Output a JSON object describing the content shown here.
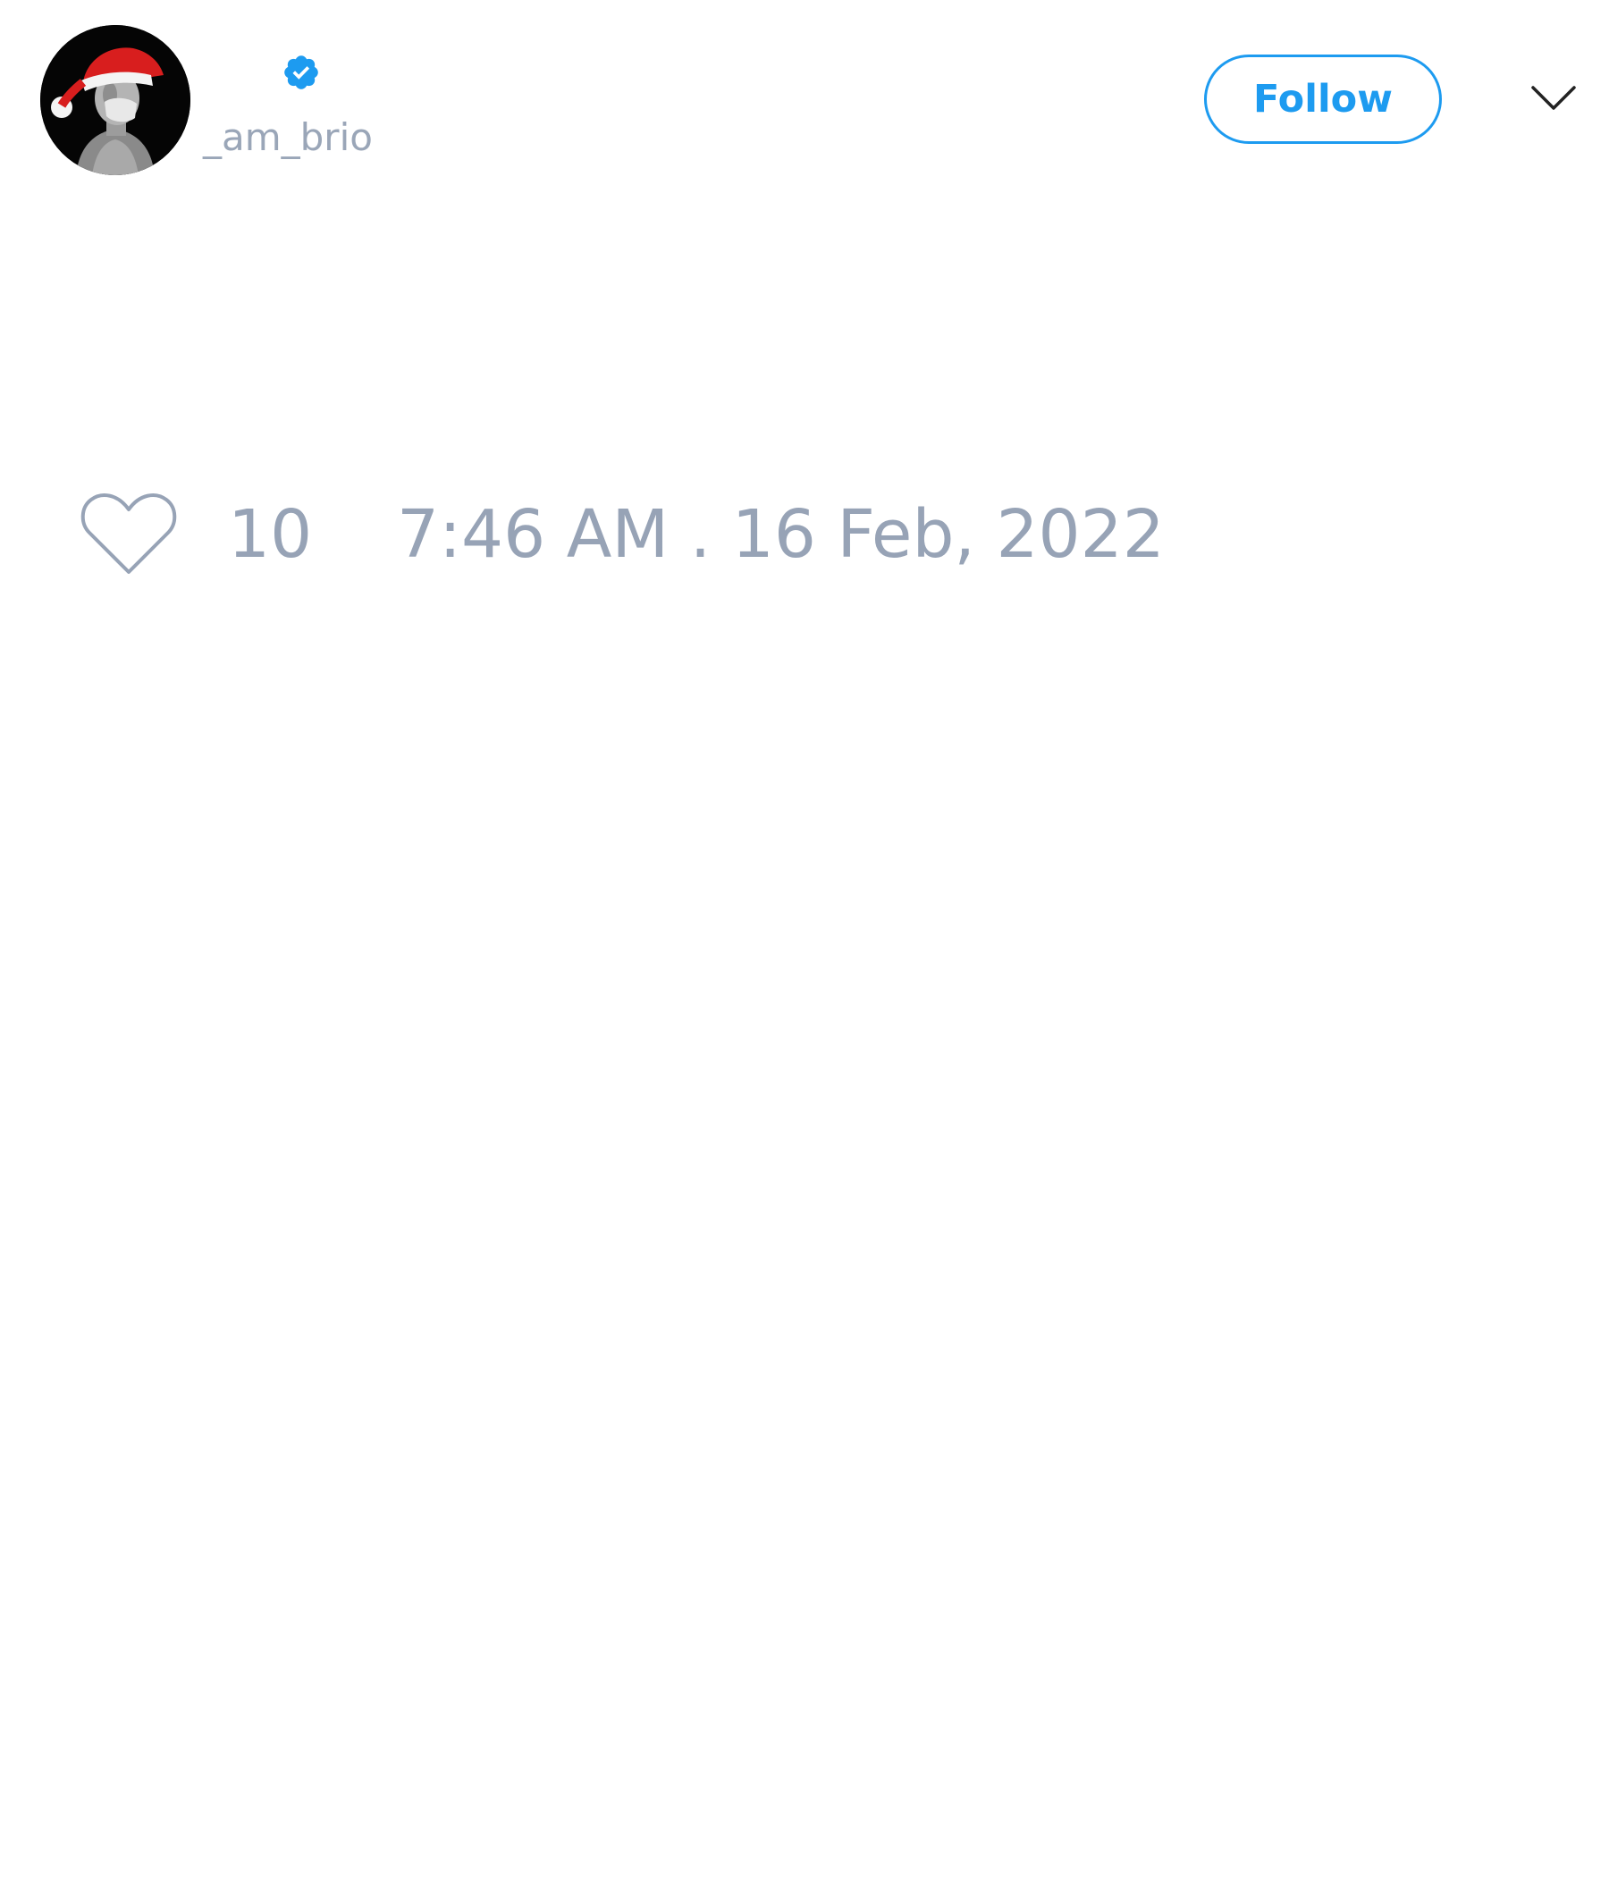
{
  "tweet": {
    "author": {
      "handle": "_am_brio",
      "verified": true,
      "avatar_icon": "avatar-santa-hat-statue"
    },
    "follow_label": "Follow",
    "menu_icon": "chevron-down-icon",
    "likes": {
      "icon": "heart-icon",
      "count": "10"
    },
    "timestamp": "7:46 AM . 16 Feb, 2022"
  },
  "colors": {
    "accent": "#1d9bf0",
    "muted_text": "#97a3b6",
    "background": "#ffffff"
  }
}
